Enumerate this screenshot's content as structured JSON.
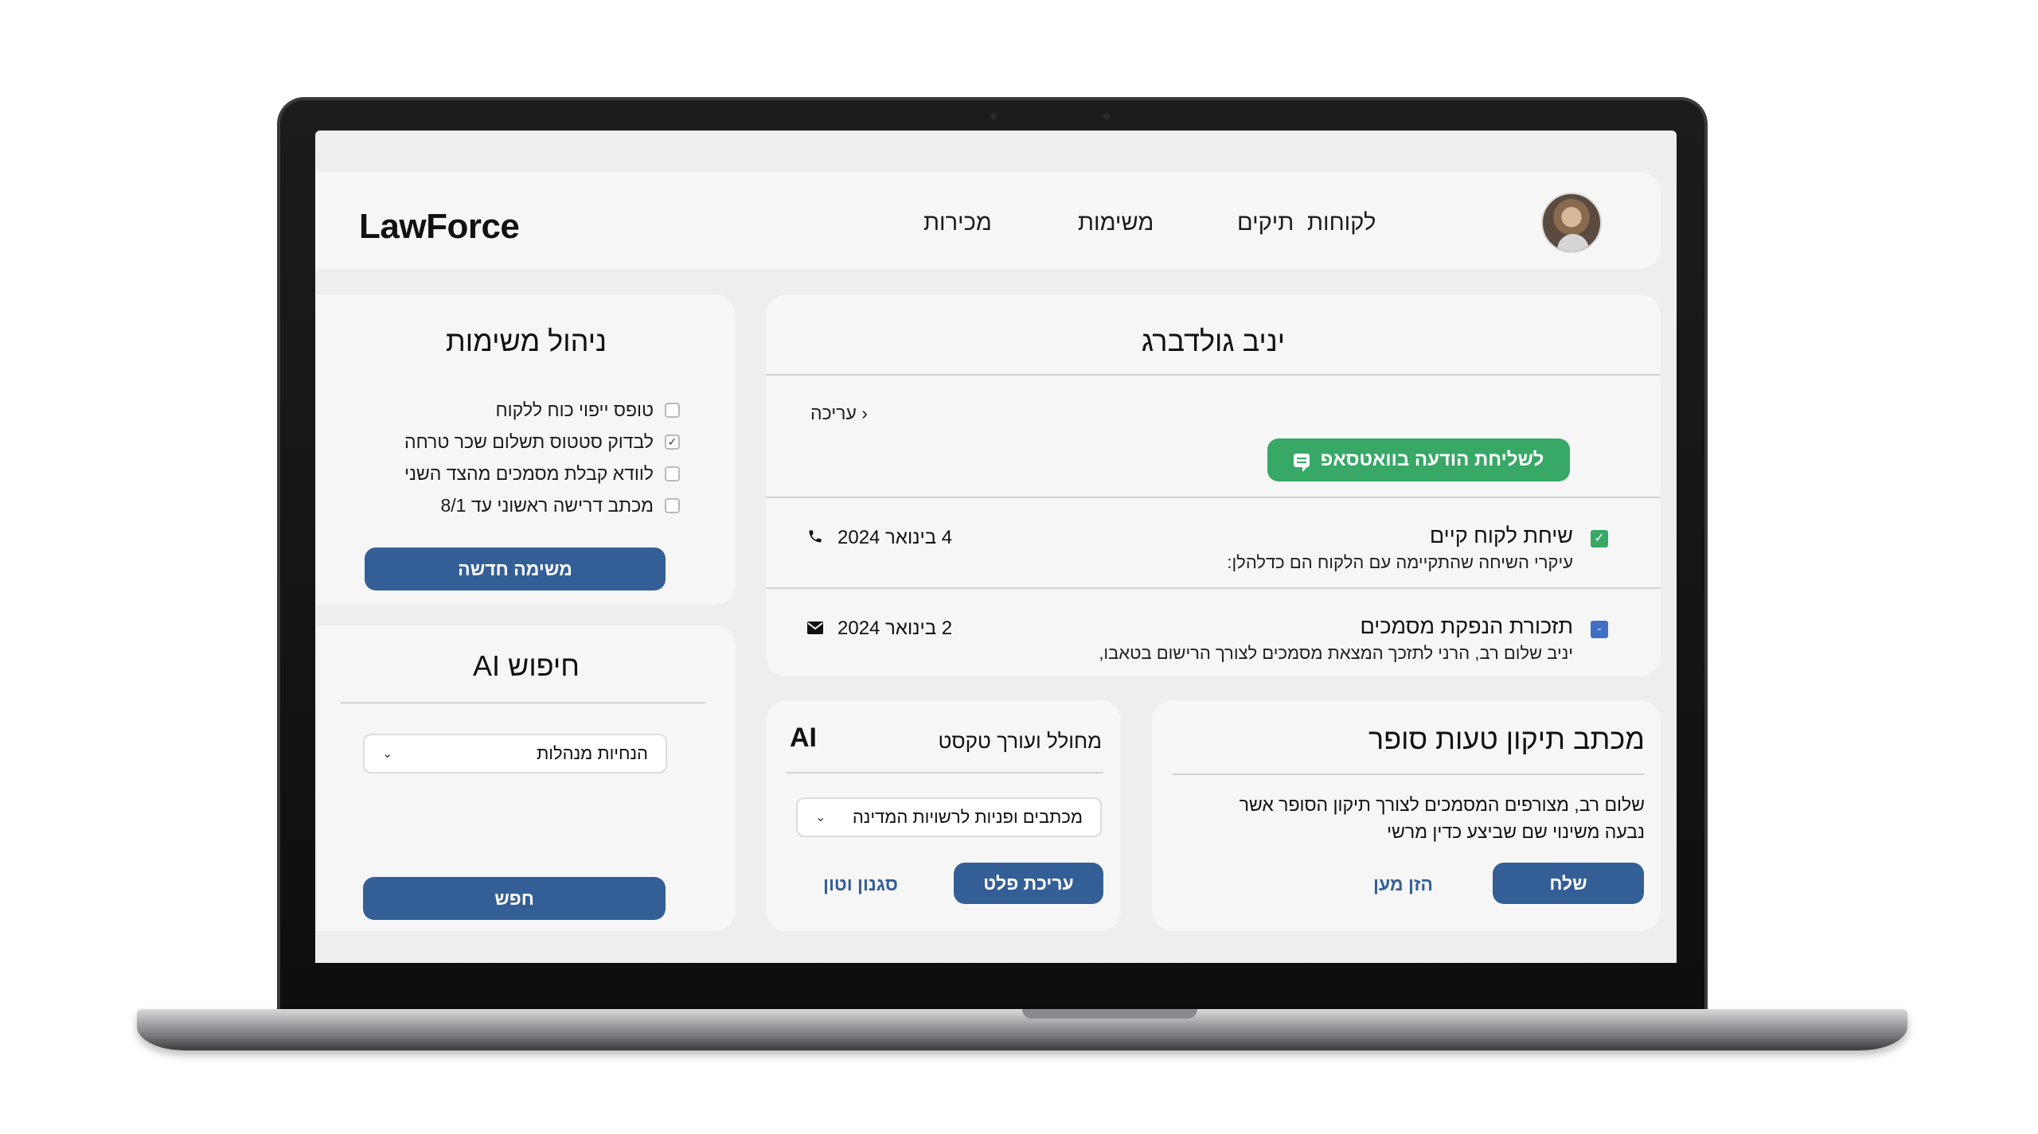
{
  "app": {
    "logo": "LawForce"
  },
  "nav": {
    "clients": "לקוחות",
    "cases": "תיקים",
    "tasks": "משימות",
    "sales": "מכירות"
  },
  "client": {
    "name": "יניב גולדברג",
    "edit_label": "‹ עריכה",
    "whatsapp_label": "לשליחת הודעה בוואטסאפ",
    "activities": [
      {
        "title": "שיחת לקוח קיים",
        "desc": "עיקרי השיחה שהתקיימה עם הלקוח הם כדלהלן:",
        "date": "4 בינואר 2024",
        "icon": "phone-icon",
        "status_color": "#37a866",
        "mark": "✓"
      },
      {
        "title": "תזכורת הנפקת מסמכים",
        "desc": "יניב שלום רב, הרני לתזכך המצאת מסמכים לצורך הרישום בטאבו,",
        "date": "2 בינואר 2024",
        "icon": "mail-icon",
        "status_color": "#3f6fc4",
        "mark": "-"
      }
    ]
  },
  "tasks": {
    "title": "ניהול משימות",
    "items": [
      {
        "label": "טופס ייפוי כוח ללקוח",
        "checked": false
      },
      {
        "label": "לבדוק סטטוס תשלום שכר טרחה",
        "checked": true
      },
      {
        "label": "לוודא קבלת מסמכים מהצד השני",
        "checked": false
      },
      {
        "label": "מכתב דרישה ראשוני עד 8/1",
        "checked": false
      }
    ],
    "new_task_label": "משימה חדשה"
  },
  "ai_search": {
    "title": "חיפוש AI",
    "select_value": "הנחיות מנהלות",
    "search_label": "חפש"
  },
  "converter": {
    "title": "מחולל ועורך טקסט",
    "badge": "AI",
    "select_value": "מכתבים ופניות לרשויות המדינה",
    "edit_output_label": "עריכת פלט",
    "style_label": "סגנון וטון"
  },
  "letter": {
    "title": "מכתב תיקון טעות סופר",
    "body_line1": "שלום רב, מצורפים המסמכים לצורך תיקון הסופר אשר",
    "body_line2": "נבעה משינוי שם שביצע כדין מרשי",
    "send_label": "שלח",
    "reply_label": "הזן מען"
  },
  "colors": {
    "primary": "#345f96",
    "whatsapp": "#37a866",
    "background": "#eeeeef"
  }
}
